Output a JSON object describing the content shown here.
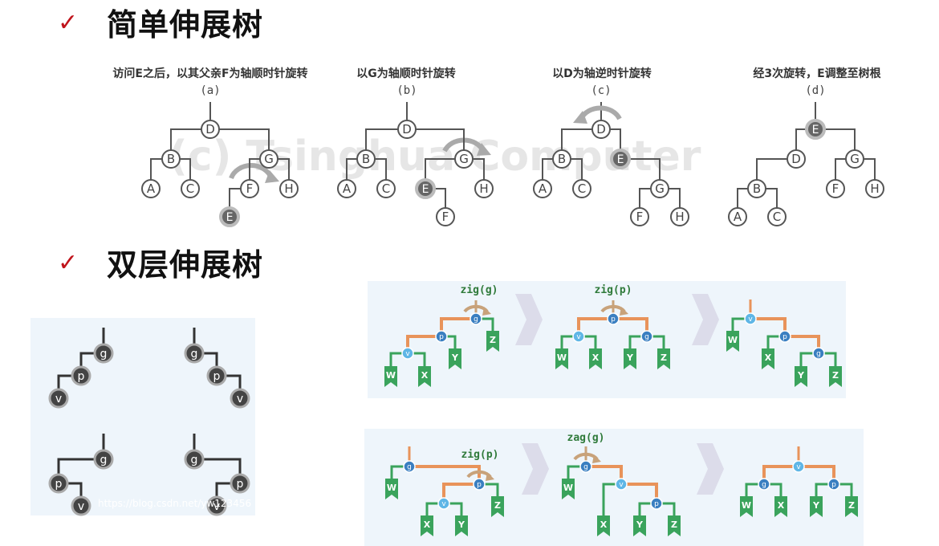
{
  "sections": [
    {
      "check": "✓",
      "title": "简单伸展树"
    },
    {
      "check": "✓",
      "title": "双层伸展树"
    }
  ],
  "simple": {
    "captions": [
      "访问E之后，以其父亲F为轴顺时针旋转",
      "以G为轴顺时针旋转",
      "以D为轴逆时针旋转",
      "经3次旋转，E调整至树根"
    ],
    "parts": [
      "(a)",
      "(b)",
      "(c)",
      "(d)"
    ],
    "watermark": "(c) Tsinghua Computer",
    "trees": [
      {
        "nodes": [
          [
            "D",
            262,
            161
          ],
          [
            "B",
            213,
            198
          ],
          [
            "G",
            335,
            198
          ],
          [
            "A",
            188,
            235
          ],
          [
            "C",
            237,
            235
          ],
          [
            "F",
            311,
            235
          ],
          [
            "H",
            360,
            235
          ],
          [
            "E",
            286,
            270
          ]
        ],
        "edges": [
          [
            "D",
            "B"
          ],
          [
            "D",
            "G"
          ],
          [
            "B",
            "A"
          ],
          [
            "B",
            "C"
          ],
          [
            "G",
            "F"
          ],
          [
            "G",
            "H"
          ],
          [
            "F",
            "E"
          ]
        ],
        "hl": [
          "E"
        ]
      },
      {
        "nodes": [
          [
            "D",
            507,
            161
          ],
          [
            "B",
            456,
            198
          ],
          [
            "G",
            578,
            198
          ],
          [
            "A",
            432,
            235
          ],
          [
            "C",
            481,
            235
          ],
          [
            "E",
            530,
            235
          ],
          [
            "H",
            603,
            235
          ],
          [
            "F",
            555,
            270
          ]
        ],
        "edges": [
          [
            "D",
            "B"
          ],
          [
            "D",
            "G"
          ],
          [
            "B",
            "A"
          ],
          [
            "B",
            "C"
          ],
          [
            "G",
            "E"
          ],
          [
            "G",
            "H"
          ],
          [
            "E",
            "F"
          ]
        ],
        "hl": [
          "E"
        ]
      },
      {
        "nodes": [
          [
            "D",
            749,
            161
          ],
          [
            "B",
            700,
            198
          ],
          [
            "E",
            773,
            198
          ],
          [
            "A",
            676,
            235
          ],
          [
            "C",
            725,
            235
          ],
          [
            "G",
            822,
            235
          ],
          [
            "F",
            797,
            270
          ],
          [
            "H",
            847,
            270
          ]
        ],
        "edges": [
          [
            "D",
            "B"
          ],
          [
            "D",
            "E"
          ],
          [
            "B",
            "A"
          ],
          [
            "B",
            "C"
          ],
          [
            "E",
            "G"
          ],
          [
            "G",
            "F"
          ],
          [
            "G",
            "H"
          ]
        ],
        "hl": [
          "E"
        ]
      },
      {
        "nodes": [
          [
            "E",
            1016,
            161
          ],
          [
            "D",
            992,
            198
          ],
          [
            "G",
            1065,
            198
          ],
          [
            "B",
            943,
            235
          ],
          [
            "F",
            1041,
            235
          ],
          [
            "H",
            1090,
            235
          ],
          [
            "A",
            919,
            270
          ],
          [
            "C",
            968,
            270
          ]
        ],
        "edges": [
          [
            "E",
            "D"
          ],
          [
            "E",
            "G"
          ],
          [
            "D",
            "B"
          ],
          [
            "B",
            "A"
          ],
          [
            "B",
            "C"
          ],
          [
            "G",
            "F"
          ],
          [
            "G",
            "H"
          ]
        ],
        "hl": [
          "E"
        ]
      }
    ]
  },
  "dual": {
    "left_nodes": [
      "g",
      "p",
      "v"
    ],
    "left_watermark": "https://blog.csdn.net/yw123456",
    "op_row1": [
      "zig(g)",
      "zig(p)"
    ],
    "op_row2": [
      "zig(p)",
      "zag(g)"
    ],
    "node_labels": [
      "g",
      "p",
      "v"
    ],
    "leaf_labels": [
      "W",
      "X",
      "Y",
      "Z"
    ]
  },
  "colors": {
    "check": "#c0141b",
    "edge_orange": "#e8935a",
    "leaf_green": "#3aa35c",
    "node_blue": "#3a7fc1",
    "node_light": "#5fb6e6"
  }
}
